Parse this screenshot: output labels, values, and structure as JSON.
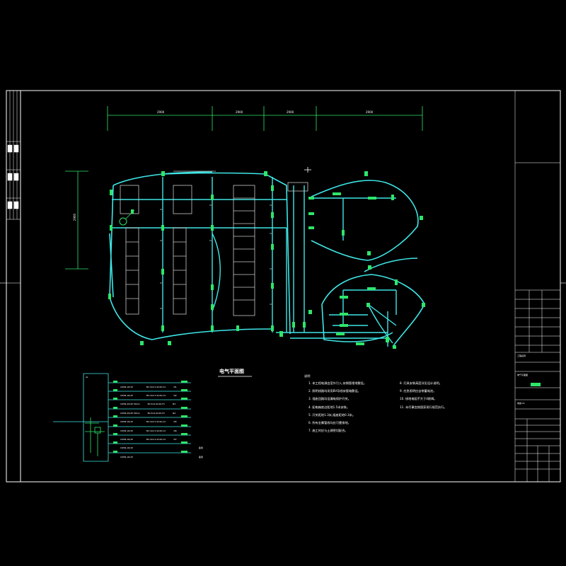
{
  "drawing": {
    "title": "电气平面图",
    "notes_heading": "说明",
    "dimensions": {
      "top": [
        "2900",
        "2900",
        "2900",
        "2900"
      ],
      "left": "2900"
    },
    "notes_left": [
      "1. 本工程电源由室外引入,穿钢管埋地敷设。",
      "2. 照明线路均采用BV导线穿管暗敷设。",
      "3. 插座回路均设漏电保护开关。",
      "4. 配电箱底边距地1.5米安装。",
      "5. 开关距地1.3米,插座距地0.3米。",
      "6. 所有金属管线均应可靠接地。",
      "7. 施工时应与土建密切配合。"
    ],
    "notes_right": [
      "8. 灯具安装高度详见设计说明。",
      "9. 应急照明应自带蓄电池。",
      "10. 接地电阻不大于4欧姆。",
      "11. 未尽事宜按国家现行规范执行。"
    ]
  },
  "panel": {
    "label": "AL",
    "rows": [
      {
        "breaker": "C65N-16/1P",
        "cable": "BV-3x2.5-SC20-CC",
        "circuit": "N1"
      },
      {
        "breaker": "C65N-16/1P",
        "cable": "BV-3x2.5-SC20-CC",
        "circuit": "N2"
      },
      {
        "breaker": "C65N-20/2P 30mA",
        "cable": "BV-3x4-SC20-FC",
        "circuit": "N3"
      },
      {
        "breaker": "C65N-20/2P 30mA",
        "cable": "BV-3x4-SC20-FC",
        "circuit": "N4"
      },
      {
        "breaker": "C65N-16/1P",
        "cable": "BV-3x2.5-SC20-CC",
        "circuit": "N5"
      },
      {
        "breaker": "C65N-16/1P",
        "cable": "BV-3x2.5-SC20-CC",
        "circuit": "N6"
      },
      {
        "breaker": "C65N-16/1P",
        "cable": "BV-3x2.5-SC20-CC",
        "circuit": "N7"
      },
      {
        "breaker": "C65N-16/1P",
        "cable": "",
        "circuit": "备用"
      },
      {
        "breaker": "C65N-16/1P",
        "cable": "",
        "circuit": "备用"
      }
    ]
  },
  "title_block": {
    "project": "工程名称",
    "drawing_name": "电气平面图",
    "drawing_no": "电施-01"
  }
}
